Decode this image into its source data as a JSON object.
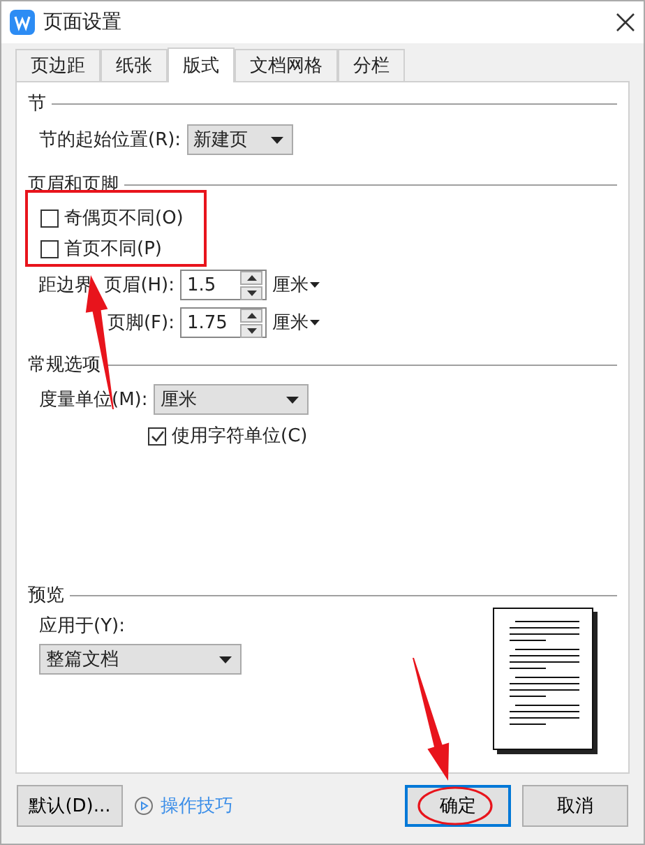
{
  "window": {
    "title": "页面设置"
  },
  "tabs": [
    {
      "label": "页边距",
      "selected": false
    },
    {
      "label": "纸张",
      "selected": false
    },
    {
      "label": "版式",
      "selected": true
    },
    {
      "label": "文档网格",
      "selected": false
    },
    {
      "label": "分栏",
      "selected": false
    }
  ],
  "section_start": {
    "heading": "节",
    "label": "节的起始位置(R):",
    "value": "新建页"
  },
  "header_footer": {
    "heading": "页眉和页脚",
    "checkboxes": [
      {
        "label": "奇偶页不同(O)",
        "checked": false
      },
      {
        "label": "首页不同(P)",
        "checked": false
      }
    ],
    "distance_label": "距边界",
    "spinners": [
      {
        "label": "页眉(H):",
        "value": "1.5",
        "unit": "厘米"
      },
      {
        "label": "页脚(F):",
        "value": "1.75",
        "unit": "厘米"
      }
    ]
  },
  "general": {
    "heading": "常规选项",
    "label": "度量单位(M):",
    "value": "厘米",
    "checkbox": {
      "label": "使用字符单位(C)",
      "checked": true
    }
  },
  "preview": {
    "heading": "预览",
    "label": "应用于(Y):",
    "value": "整篇文档"
  },
  "footer": {
    "default_button": "默认(D)...",
    "tips_link": "操作技巧",
    "buttons": [
      {
        "label": "确定",
        "selected": true
      },
      {
        "label": "取消",
        "selected": false
      }
    ]
  }
}
